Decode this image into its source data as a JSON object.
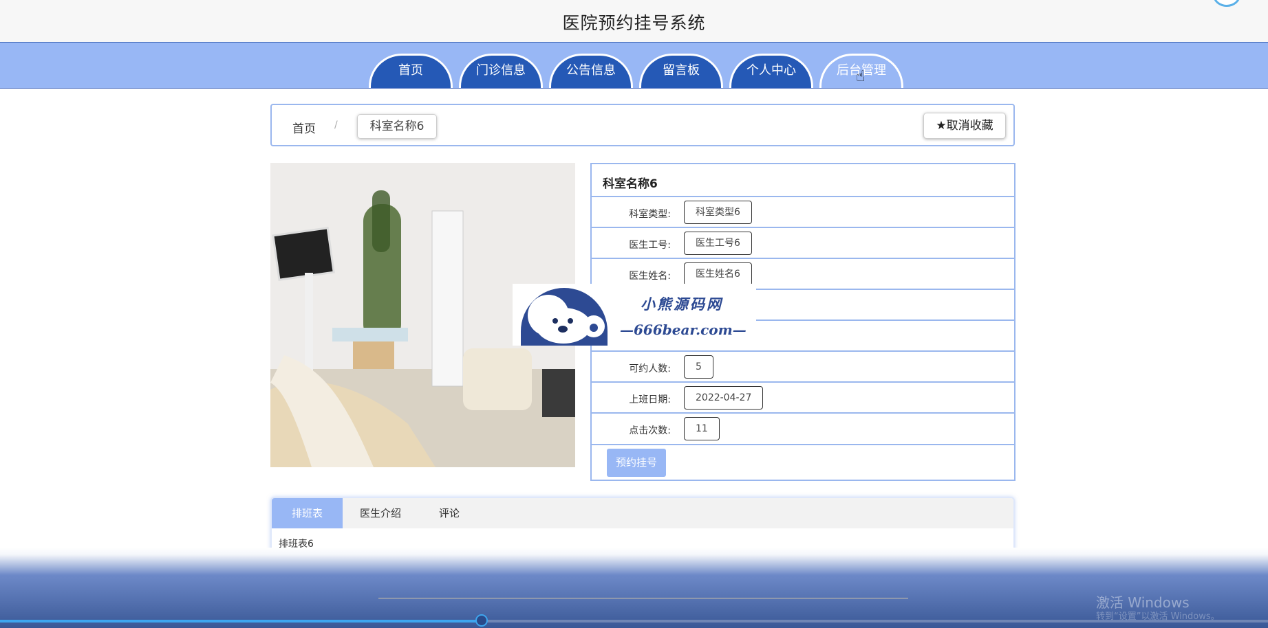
{
  "header": {
    "title": "医院预约挂号系统"
  },
  "nav": {
    "items": [
      "首页",
      "门诊信息",
      "公告信息",
      "留言板",
      "个人中心",
      "后台管理"
    ]
  },
  "breadcrumb": {
    "home": "首页",
    "separator": "/",
    "current": "科室名称6",
    "favorite_label": "★取消收藏"
  },
  "detail": {
    "title": "科室名称6",
    "rows": [
      {
        "label": "科室类型:",
        "value": "科室类型6"
      },
      {
        "label": "医生工号:",
        "value": "医生工号6"
      },
      {
        "label": "医生姓名:",
        "value": "医生姓名6"
      },
      {
        "label": "",
        "value": ""
      },
      {
        "label": "",
        "value": ""
      },
      {
        "label": "可约人数:",
        "value": "5"
      },
      {
        "label": "上班日期:",
        "value": "2022-04-27"
      },
      {
        "label": "点击次数:",
        "value": "11"
      }
    ],
    "reserve_label": "预约挂号"
  },
  "watermark": {
    "title": "小熊源码网",
    "url": "—666bear.com—"
  },
  "tabs": {
    "items": [
      "排班表",
      "医生介绍",
      "评论"
    ],
    "active": 0,
    "content": "排班表6"
  },
  "video": {
    "progress": 0.38
  },
  "os_watermark": {
    "line1": "激活 Windows",
    "line2": "转到“设置”以激活 Windows。"
  },
  "colors": {
    "nav_bg": "#98b7f5",
    "tab_blue": "#2559b6",
    "border": "#9ab7ee"
  }
}
